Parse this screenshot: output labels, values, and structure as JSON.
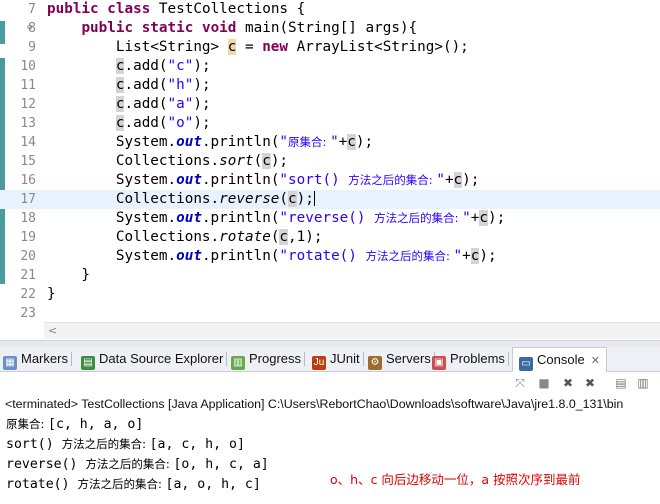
{
  "editor": {
    "lines": [
      {
        "no": "7",
        "fold": "",
        "parts": [
          [
            "kw",
            "public "
          ],
          [
            "kw",
            "class "
          ],
          [
            "p",
            "TestCollections {"
          ]
        ]
      },
      {
        "no": "8",
        "fold": "⊖",
        "parts": [
          [
            "p",
            "    "
          ],
          [
            "kw",
            "public "
          ],
          [
            "kw",
            "static "
          ],
          [
            "kw",
            "void "
          ],
          [
            "p",
            "main(String[] args){"
          ]
        ]
      },
      {
        "no": "9",
        "fold": "",
        "parts": [
          [
            "p",
            "        List<String> "
          ],
          [
            "vd",
            "c"
          ],
          [
            "p",
            " = "
          ],
          [
            "kw",
            "new "
          ],
          [
            "p",
            "ArrayList<String>();"
          ]
        ]
      },
      {
        "no": "10",
        "fold": "",
        "parts": [
          [
            "p",
            "        "
          ],
          [
            "v",
            "c"
          ],
          [
            "p",
            ".add("
          ],
          [
            "s",
            "\"c\""
          ],
          [
            "p",
            ");"
          ]
        ]
      },
      {
        "no": "11",
        "fold": "",
        "parts": [
          [
            "p",
            "        "
          ],
          [
            "v",
            "c"
          ],
          [
            "p",
            ".add("
          ],
          [
            "s",
            "\"h\""
          ],
          [
            "p",
            ");"
          ]
        ]
      },
      {
        "no": "12",
        "fold": "",
        "parts": [
          [
            "p",
            "        "
          ],
          [
            "v",
            "c"
          ],
          [
            "p",
            ".add("
          ],
          [
            "s",
            "\"a\""
          ],
          [
            "p",
            ");"
          ]
        ]
      },
      {
        "no": "13",
        "fold": "",
        "parts": [
          [
            "p",
            "        "
          ],
          [
            "v",
            "c"
          ],
          [
            "p",
            ".add("
          ],
          [
            "s",
            "\"o\""
          ],
          [
            "p",
            ");"
          ]
        ]
      },
      {
        "no": "14",
        "fold": "",
        "parts": [
          [
            "p",
            "        System."
          ],
          [
            "f",
            "out"
          ],
          [
            "p",
            ".println("
          ],
          [
            "s",
            "\""
          ],
          [
            "sc",
            "原集合: "
          ],
          [
            "s",
            "\""
          ],
          [
            "p",
            "+"
          ],
          [
            "v",
            "c"
          ],
          [
            "p",
            ");"
          ]
        ]
      },
      {
        "no": "15",
        "fold": "",
        "parts": [
          [
            "p",
            "        Collections."
          ],
          [
            "i",
            "sort"
          ],
          [
            "p",
            "("
          ],
          [
            "v",
            "c"
          ],
          [
            "p",
            ");"
          ]
        ]
      },
      {
        "no": "16",
        "fold": "",
        "parts": [
          [
            "p",
            "        System."
          ],
          [
            "f",
            "out"
          ],
          [
            "p",
            ".println("
          ],
          [
            "s",
            "\"sort() "
          ],
          [
            "sc",
            "方法之后的集合: "
          ],
          [
            "s",
            "\""
          ],
          [
            "p",
            "+"
          ],
          [
            "v",
            "c"
          ],
          [
            "p",
            ");"
          ]
        ]
      },
      {
        "no": "17",
        "fold": "",
        "hl": true,
        "parts": [
          [
            "p",
            "        Collections."
          ],
          [
            "i",
            "reverse"
          ],
          [
            "p",
            "("
          ],
          [
            "v",
            "c"
          ],
          [
            "p",
            ");"
          ],
          [
            "cur",
            ""
          ]
        ]
      },
      {
        "no": "18",
        "fold": "",
        "parts": [
          [
            "p",
            "        System."
          ],
          [
            "f",
            "out"
          ],
          [
            "p",
            ".println("
          ],
          [
            "s",
            "\"reverse() "
          ],
          [
            "sc",
            "方法之后的集合: "
          ],
          [
            "s",
            "\""
          ],
          [
            "p",
            "+"
          ],
          [
            "v",
            "c"
          ],
          [
            "p",
            ");"
          ]
        ]
      },
      {
        "no": "19",
        "fold": "",
        "parts": [
          [
            "p",
            "        Collections."
          ],
          [
            "i",
            "rotate"
          ],
          [
            "p",
            "("
          ],
          [
            "v",
            "c"
          ],
          [
            "p",
            ",1);"
          ]
        ]
      },
      {
        "no": "20",
        "fold": "",
        "parts": [
          [
            "p",
            "        System."
          ],
          [
            "f",
            "out"
          ],
          [
            "p",
            ".println("
          ],
          [
            "s",
            "\"rotate() "
          ],
          [
            "sc",
            "方法之后的集合: "
          ],
          [
            "s",
            "\""
          ],
          [
            "p",
            "+"
          ],
          [
            "v",
            "c"
          ],
          [
            "p",
            ");"
          ]
        ]
      },
      {
        "no": "21",
        "fold": "",
        "parts": [
          [
            "p",
            "    }"
          ]
        ]
      },
      {
        "no": "22",
        "fold": "",
        "parts": [
          [
            "p",
            "}"
          ]
        ]
      },
      {
        "no": "23",
        "fold": "",
        "parts": []
      }
    ],
    "scroll_arrow": "<"
  },
  "tabs": [
    {
      "id": "markers",
      "label": "Markers",
      "icon": "markers-icon",
      "color": "#6b8fc7",
      "glyph": "▦"
    },
    {
      "id": "data-source",
      "label": "Data Source Explorer",
      "icon": "database-icon",
      "color": "#3e8e41",
      "glyph": "▤"
    },
    {
      "id": "progress",
      "label": "Progress",
      "icon": "progress-icon",
      "color": "#6aa84f",
      "glyph": "▥"
    },
    {
      "id": "junit",
      "label": "JUnit",
      "icon": "junit-icon",
      "color": "#b7410e",
      "glyph": "Ju"
    },
    {
      "id": "servers",
      "label": "Servers",
      "icon": "servers-icon",
      "color": "#9c6b2e",
      "glyph": "⚙"
    },
    {
      "id": "problems",
      "label": "Problems",
      "icon": "problems-icon",
      "color": "#c94f4f",
      "glyph": "▣"
    },
    {
      "id": "console",
      "label": "Console",
      "icon": "console-icon",
      "color": "#3b6aa0",
      "glyph": "▭",
      "active": true,
      "close": "✕"
    }
  ],
  "console": {
    "terminated": "<terminated> TestCollections [Java Application] C:\\Users\\RebortChao\\Downloads\\software\\Java\\jre1.8.0_131\\bin",
    "lines": [
      [
        [
          "cjk",
          "原集合: "
        ],
        [
          "m",
          "[c, h, a, o]"
        ]
      ],
      [
        [
          "m",
          "sort() "
        ],
        [
          "cjk",
          "方法之后的集合: "
        ],
        [
          "m",
          "[a, c, h, o]"
        ]
      ],
      [
        [
          "m",
          "reverse() "
        ],
        [
          "cjk",
          "方法之后的集合: "
        ],
        [
          "m",
          "[o, h, c, a]"
        ]
      ],
      [
        [
          "m",
          "rotate() "
        ],
        [
          "cjk",
          "方法之后的集合: "
        ],
        [
          "m",
          "[a, o, h, c]"
        ]
      ]
    ],
    "annotation": "o、h、c 向后边移动一位，a 按照次序到最前"
  },
  "colors": {
    "keyword": "#7f0055",
    "string": "#2a00ff",
    "field": "#0000c0",
    "annotation": "#e00000"
  }
}
